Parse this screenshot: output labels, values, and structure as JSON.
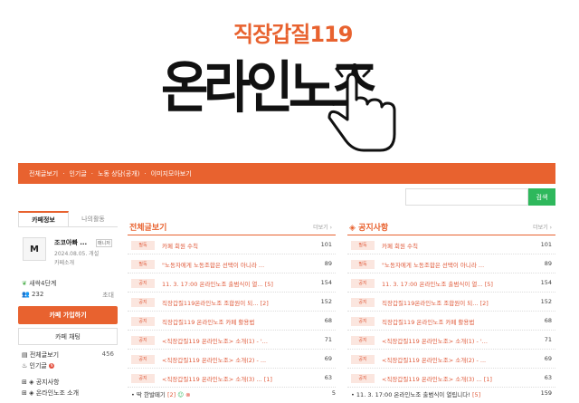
{
  "banner": {
    "subtitle": "직장갑질119",
    "title": "온라인노조"
  },
  "nav": {
    "items": [
      "전체글보기",
      "인기글",
      "노동 상담(공개)",
      "이미지모아보기"
    ],
    "separator": "·"
  },
  "search": {
    "button_label": "검색",
    "placeholder": ""
  },
  "sidebar": {
    "tabs": [
      "카페정보",
      "나의활동"
    ],
    "profile": {
      "name": "조코아빠 ...",
      "role": "매니저",
      "date": "2024.08.05. 개설",
      "intro": "카페소개",
      "avatar_text": "M"
    },
    "level": "새싹4단계",
    "members": "232",
    "invite": "초대",
    "join_label": "카페 가입하기",
    "chat_label": "카페 채팅",
    "menu": [
      {
        "label": "전체글보기",
        "count": "456"
      },
      {
        "label": "인기글",
        "badge": "N"
      },
      {
        "label": "공지사항",
        "count": ""
      },
      {
        "label": "온라인노조 소개",
        "count": ""
      }
    ]
  },
  "board_all": {
    "title": "전체글보기",
    "more": "더보기 ›",
    "rows": [
      {
        "tag": "필독",
        "title": "카페 회원 수칙",
        "extra": "",
        "count": "101"
      },
      {
        "tag": "필독",
        "title": "\"노동자에게 노동조합은 선택이 아니라 ...",
        "extra": "",
        "count": "89"
      },
      {
        "tag": "공지",
        "title": "11. 3. 17:00 온라인노조 출범식이 열...",
        "extra": "[5]",
        "count": "154"
      },
      {
        "tag": "공지",
        "title": "직장갑질119온라인노조 조합원이 되...",
        "extra": "[2]",
        "count": "152"
      },
      {
        "tag": "공지",
        "title": "직장갑질119 온라인노조 카페 활용법",
        "extra": "",
        "count": "68"
      },
      {
        "tag": "공지",
        "title": "<직장갑질119 온라인노조> 소개(1) - '...",
        "extra": "",
        "count": "71"
      },
      {
        "tag": "공지",
        "title": "<직장갑질119 온라인노조> 소개(2) - ...",
        "extra": "",
        "count": "69"
      },
      {
        "tag": "공지",
        "title": "<직장갑질119 온라인노조> 소개(3) ...",
        "extra": "[1]",
        "count": "63"
      }
    ],
    "last": {
      "title": "딱 한발떼기",
      "extra": "[2]",
      "count": "5"
    }
  },
  "board_notice": {
    "title": "공지사항",
    "more": "더보기 ›",
    "rows": [
      {
        "tag": "필독",
        "title": "카페 회원 수칙",
        "extra": "",
        "count": "101"
      },
      {
        "tag": "필독",
        "title": "\"노동자에게 노동조합은 선택이 아니라 ...",
        "extra": "",
        "count": "89"
      },
      {
        "tag": "공지",
        "title": "11. 3. 17:00 온라인노조 출범식이 열...",
        "extra": "[5]",
        "count": "154"
      },
      {
        "tag": "공지",
        "title": "직장갑질119온라인노조 조합원이 되...",
        "extra": "[2]",
        "count": "152"
      },
      {
        "tag": "공지",
        "title": "직장갑질119 온라인노조 카페 활용법",
        "extra": "",
        "count": "68"
      },
      {
        "tag": "공지",
        "title": "<직장갑질119 온라인노조> 소개(1) - '...",
        "extra": "",
        "count": "71"
      },
      {
        "tag": "공지",
        "title": "<직장갑질119 온라인노조> 소개(2) - ...",
        "extra": "",
        "count": "69"
      },
      {
        "tag": "공지",
        "title": "<직장갑질119 온라인노조> 소개(3) ...",
        "extra": "[1]",
        "count": "63"
      }
    ],
    "last": {
      "title": "11. 3. 17:00 온라인노조 출범식이 열립니다!",
      "extra": "[5]",
      "count": "159"
    }
  },
  "colors": {
    "accent": "#e8622f",
    "search": "#2eb85c"
  }
}
